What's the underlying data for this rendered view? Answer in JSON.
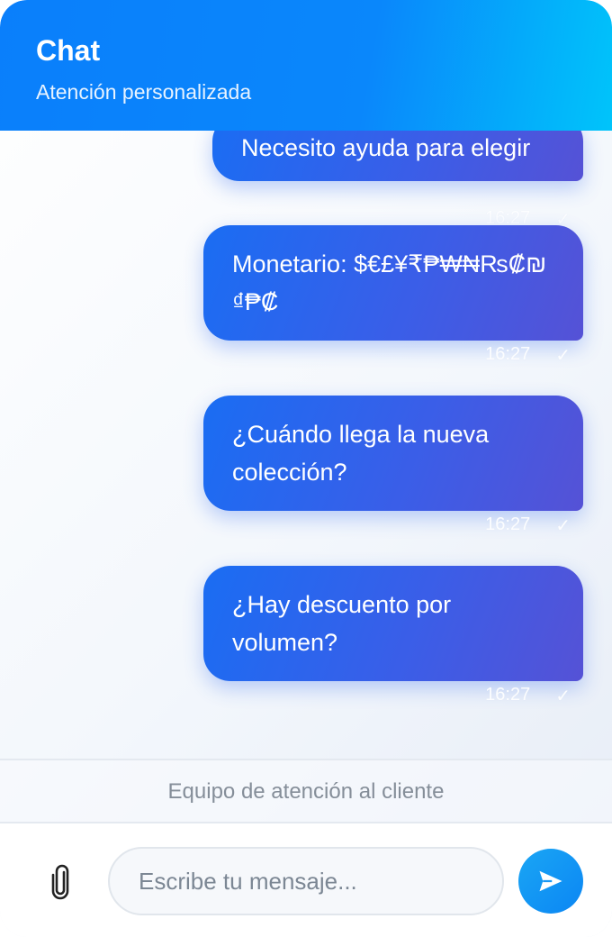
{
  "header": {
    "title": "Chat",
    "subtitle": "Atención personalizada"
  },
  "messages": [
    {
      "text": "Necesito ayuda para elegir",
      "time": "16:27",
      "status": "✓"
    },
    {
      "text": "Monetario: $€£¥₹₱₩₦₨₡₪₫₱₡",
      "time": "16:27",
      "status": "✓"
    },
    {
      "text": "¿Cuándo llega la nueva colección?",
      "time": "16:27",
      "status": "✓"
    },
    {
      "text": "¿Hay descuento por volumen?",
      "time": "16:27",
      "status": "✓"
    }
  ],
  "footer": {
    "note": "Equipo de atención al cliente"
  },
  "composer": {
    "placeholder": "Escribe tu mensaje...",
    "attach_icon": "paperclip-icon",
    "send_icon": "send-icon"
  },
  "colors": {
    "accent": "#0a7ffb",
    "bubble_start": "#1a6df3",
    "bubble_end": "#5552d6"
  }
}
